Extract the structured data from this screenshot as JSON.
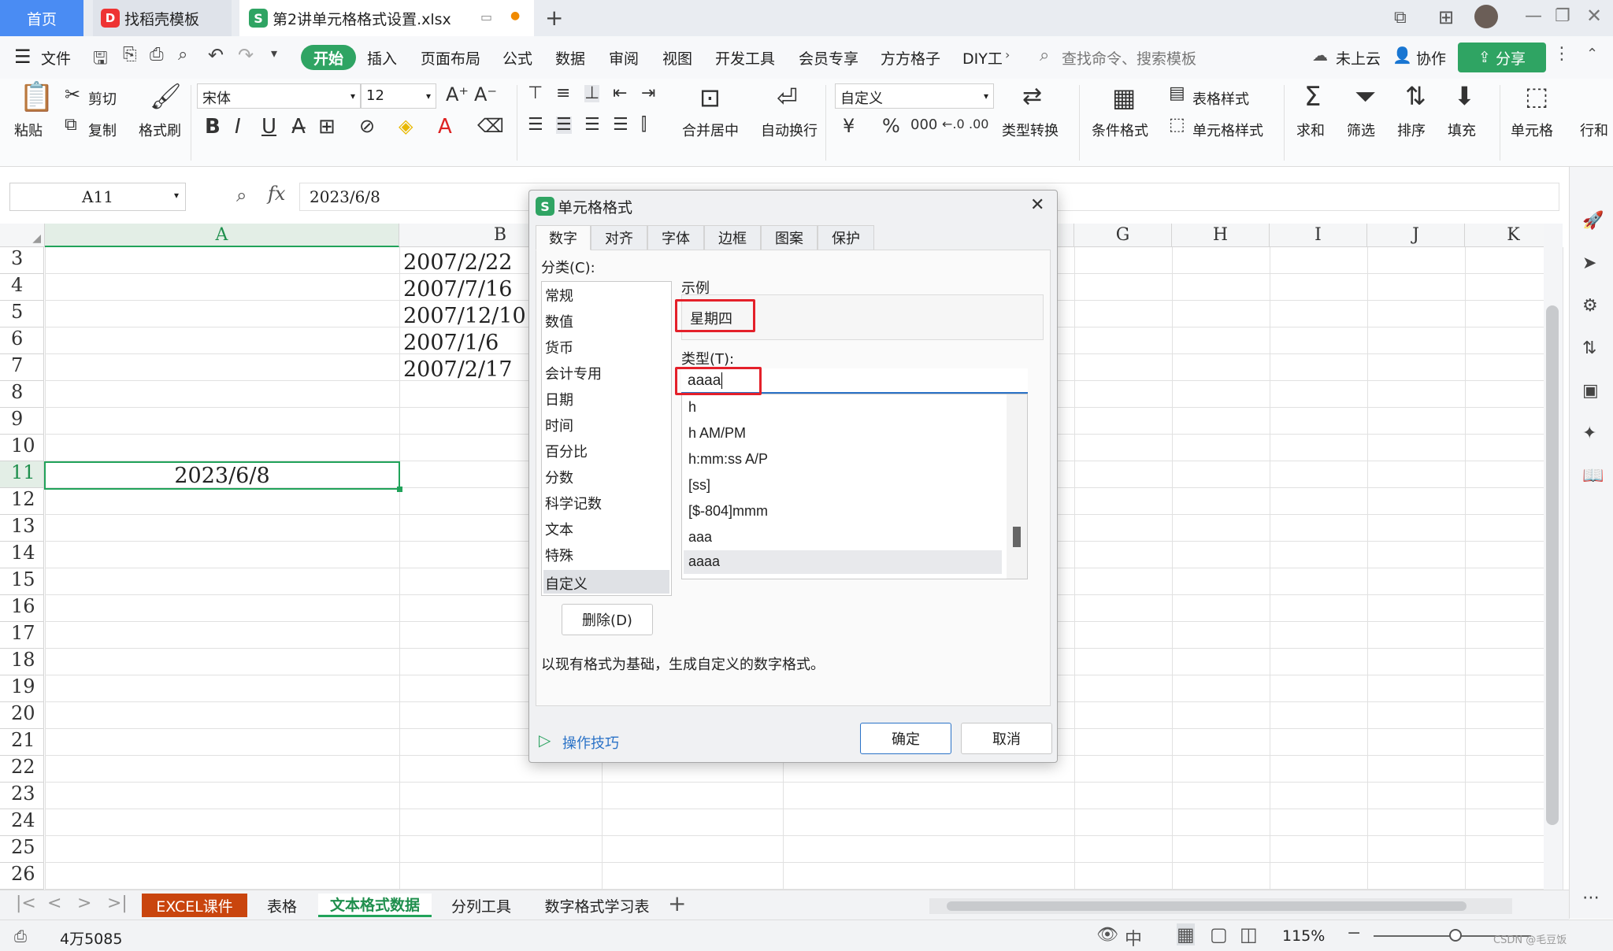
{
  "titlebar": {
    "home_tab": "首页",
    "template_tab": "找稻壳模板",
    "file_tab": "第2讲单元格格式设置.xlsx",
    "new_tab_symbol": "+"
  },
  "menubar": {
    "file": "文件",
    "items": [
      "开始",
      "插入",
      "页面布局",
      "公式",
      "数据",
      "审阅",
      "视图",
      "开发工具",
      "会员专享",
      "方方格子",
      "DIY工"
    ],
    "search_placeholder": "查找命令、搜索模板",
    "cloud": "未上云",
    "collab": "协作",
    "share": "分享"
  },
  "ribbon": {
    "paste": "粘贴",
    "cut": "剪切",
    "copy": "复制",
    "format_painter": "格式刷",
    "font_name": "宋体",
    "font_size": "12",
    "merge_center": "合并居中",
    "wrap_text": "自动换行",
    "number_format": "自定义",
    "type_convert": "类型转换",
    "cond_format": "条件格式",
    "table_style": "表格样式",
    "cell_style": "单元格样式",
    "sum": "求和",
    "filter": "筛选",
    "sort": "排序",
    "fill": "填充",
    "cells": "单元格",
    "rows_cols": "行和"
  },
  "formula_bar": {
    "name_box": "A11",
    "fx": "fx",
    "value": "2023/6/8"
  },
  "grid": {
    "columns": [
      "A",
      "B",
      "G",
      "H",
      "I",
      "J",
      "K"
    ],
    "rows": [
      "3",
      "4",
      "5",
      "6",
      "7",
      "8",
      "9",
      "10",
      "11",
      "12",
      "13",
      "14",
      "15",
      "16",
      "17",
      "18",
      "19",
      "20",
      "21",
      "22",
      "23",
      "24",
      "25",
      "26"
    ],
    "b_values": [
      "2007/2/22",
      "2007/7/16",
      "2007/12/10",
      "2007/1/6",
      "2007/2/17"
    ],
    "a11_value": "2023/6/8"
  },
  "sheets": {
    "tabs": [
      "EXCEL课件",
      "表格",
      "文本格式数据",
      "分列工具",
      "数字格式学习表"
    ],
    "active": "文本格式数据",
    "add": "+"
  },
  "status": {
    "count": "4万5085",
    "zoom": "115%",
    "watermark": "CSDN @毛豆饭"
  },
  "dialog": {
    "title": "单元格格式",
    "tabs": [
      "数字",
      "对齐",
      "字体",
      "边框",
      "图案",
      "保护"
    ],
    "category_label": "分类(C):",
    "categories": [
      "常规",
      "数值",
      "货币",
      "会计专用",
      "日期",
      "时间",
      "百分比",
      "分数",
      "科学记数",
      "文本",
      "特殊",
      "自定义"
    ],
    "selected_category": "自定义",
    "sample_label": "示例",
    "sample_value": "星期四",
    "type_label": "类型(T):",
    "type_value": "aaaa",
    "type_list": [
      "h",
      "h AM/PM",
      "h:mm:ss A/P",
      "[ss]",
      "[$-804]mmm",
      "aaa",
      "aaaa"
    ],
    "delete_button": "删除(D)",
    "description": "以现有格式为基础，生成自定义的数字格式。",
    "tips": "操作技巧",
    "ok": "确定",
    "cancel": "取消"
  },
  "colors": {
    "accent_green": "#2fa463",
    "selection_green": "#21a35a",
    "highlight_red": "#e4202a",
    "home_tab_blue": "#4a8cf3",
    "excel_tab_red": "#c9450e"
  }
}
